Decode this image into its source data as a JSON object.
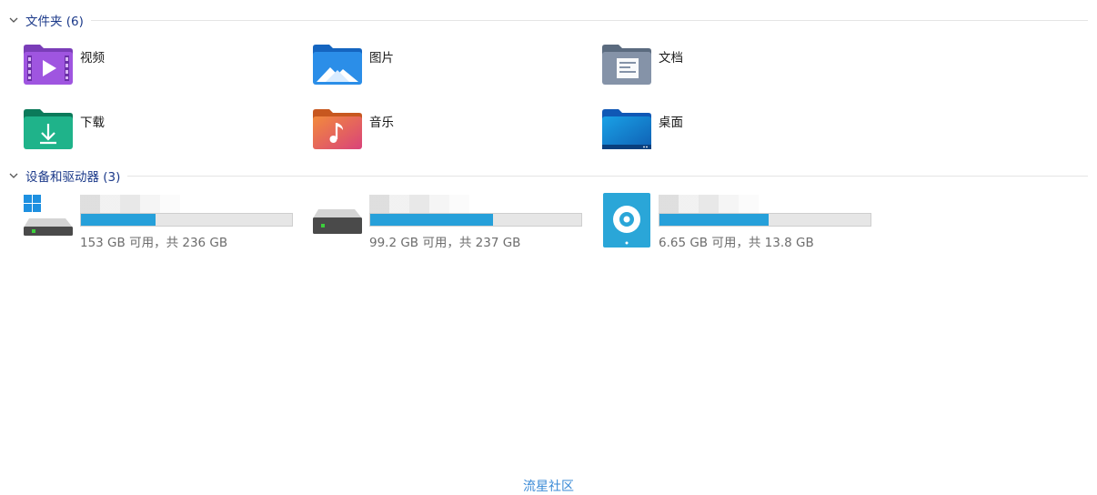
{
  "sections": {
    "folders": {
      "title": "文件夹 (6)"
    },
    "drives": {
      "title": "设备和驱动器 (3)"
    }
  },
  "folders": [
    {
      "name": "视频",
      "icon": "videos-folder-icon"
    },
    {
      "name": "图片",
      "icon": "pictures-folder-icon"
    },
    {
      "name": "文档",
      "icon": "documents-folder-icon"
    },
    {
      "name": "下载",
      "icon": "downloads-folder-icon"
    },
    {
      "name": "音乐",
      "icon": "music-folder-icon"
    },
    {
      "name": "桌面",
      "icon": "desktop-folder-icon"
    }
  ],
  "drives": [
    {
      "info": "153 GB 可用，共 236 GB",
      "used_fraction": 0.352,
      "icon": "system-drive-icon"
    },
    {
      "info": "99.2 GB 可用，共 237 GB",
      "used_fraction": 0.581,
      "icon": "hard-drive-icon"
    },
    {
      "info": "6.65 GB 可用，共 13.8 GB",
      "used_fraction": 0.518,
      "icon": "dvd-drive-icon"
    }
  ],
  "footer": {
    "text": "流星社区"
  },
  "colors": {
    "accent": "#26a0da",
    "header": "#1c3a8a",
    "footer": "#3a8ad6"
  }
}
